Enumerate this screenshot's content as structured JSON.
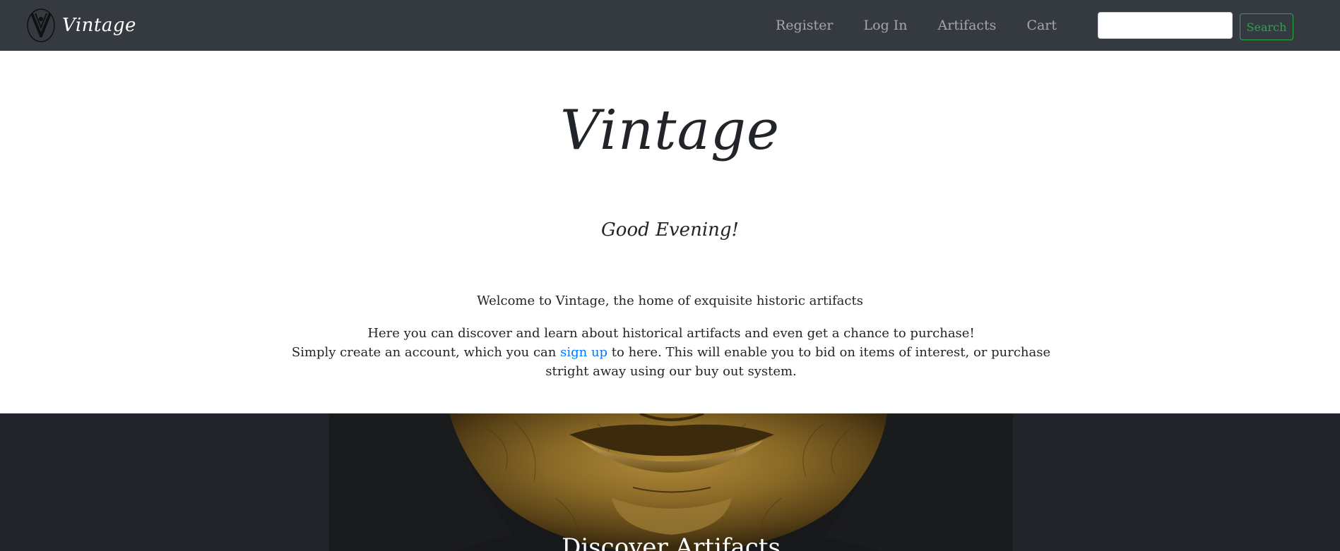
{
  "navbar": {
    "brand_name": "Vintage",
    "links": [
      {
        "label": "Register"
      },
      {
        "label": "Log In"
      },
      {
        "label": "Artifacts"
      },
      {
        "label": "Cart"
      }
    ],
    "search": {
      "value": "",
      "placeholder": ""
    },
    "search_button_label": "Search"
  },
  "hero": {
    "title": "Vintage",
    "greeting": "Good Evening!",
    "welcome": "Welcome to Vintage, the home of exquisite historic artifacts",
    "description_line1": "Here you can discover and learn about historical artifacts and even get a chance to purchase!",
    "description_pre_link": "Simply create an account, which you can ",
    "description_link": "sign up",
    "description_post_link": " to here. This will enable you to bid on items of interest, or purchase stright away using our buy out system."
  },
  "carousel": {
    "caption": "Discover Artifacts",
    "image": "gold-mask-image"
  },
  "colors": {
    "navbar_bg": "#343a40",
    "carousel_bg": "#212529",
    "link": "#007bff",
    "search_button": "#28a745"
  }
}
